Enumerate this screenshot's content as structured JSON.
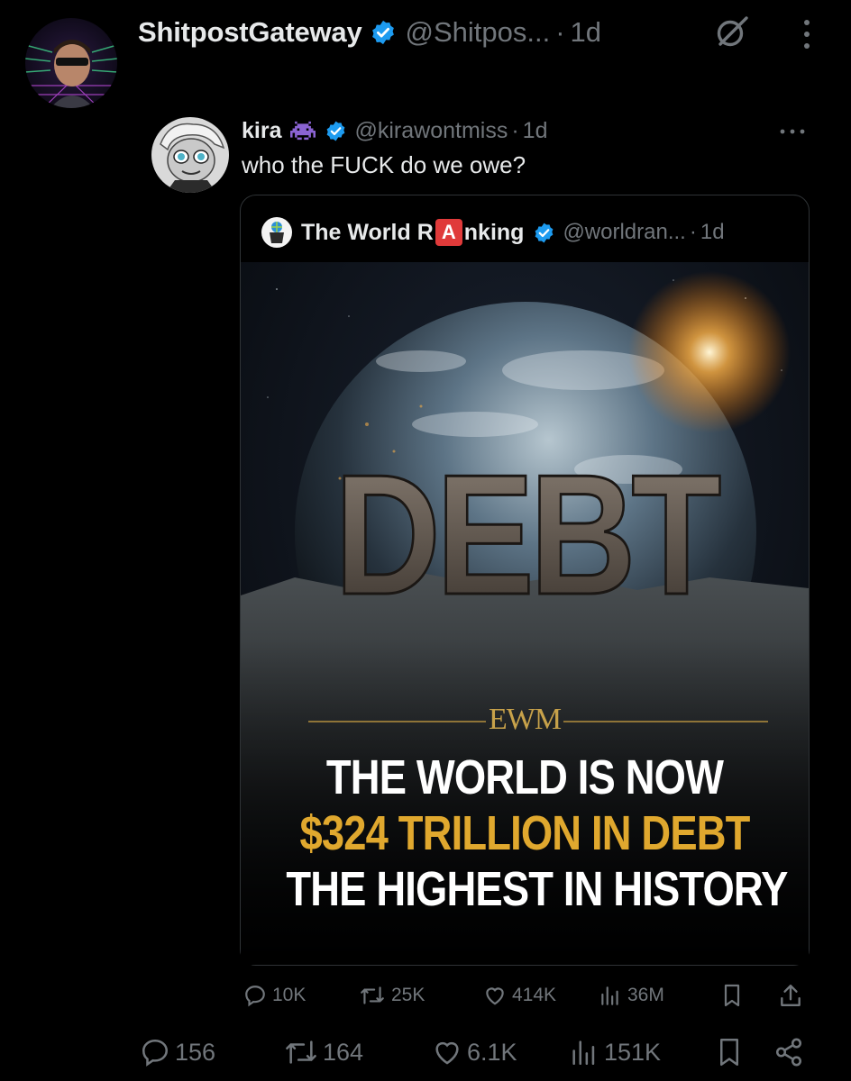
{
  "outer_tweet": {
    "display_name": "ShitpostGateway",
    "handle": "@Shitpos...",
    "separator": "·",
    "time": "1d"
  },
  "reply_tweet": {
    "display_name": "kira",
    "handle": "@kirawontmiss",
    "separator": "·",
    "time": "1d",
    "text": "who the FUCK do we owe?"
  },
  "quoted_tweet": {
    "display_name_pre": "The World R",
    "display_name_badge": "A",
    "display_name_post": "nking",
    "handle": "@worldran...",
    "separator": "·",
    "time": "1d",
    "media": {
      "relief_text": "DEBT",
      "brand_mark": "EWM",
      "headline_line1": "THE WORLD IS NOW",
      "headline_line2": "$324 TRILLION IN DEBT",
      "headline_line3": "THE HIGHEST IN HISTORY"
    }
  },
  "quoted_actions": {
    "replies": "10K",
    "reposts": "25K",
    "likes": "414K",
    "views": "36M"
  },
  "outer_actions": {
    "replies": "156",
    "reposts": "164",
    "likes": "6.1K",
    "views": "151K"
  },
  "colors": {
    "background": "#000000",
    "primary_text": "#e7e9ea",
    "secondary_text": "#71767b",
    "verified_blue": "#1d9bf0",
    "headline_gold": "#e0a82e",
    "badge_red": "#e03a3a"
  }
}
